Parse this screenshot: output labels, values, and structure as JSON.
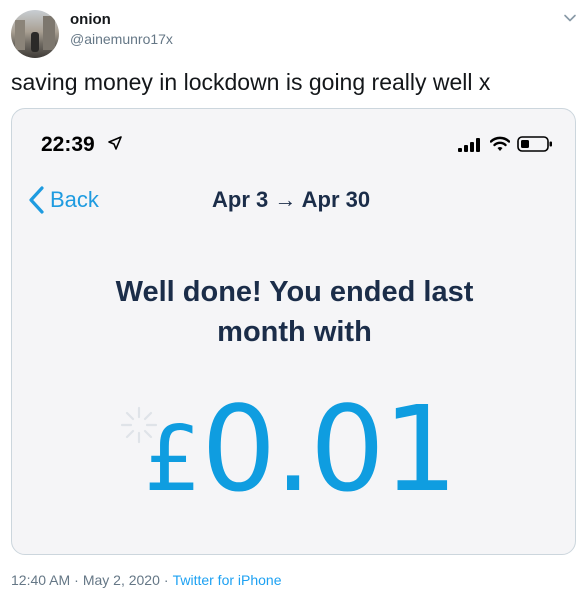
{
  "tweet": {
    "display_name": "onion",
    "handle": "@ainemunro17x",
    "text": "saving money in lockdown is going really well x",
    "timestamp": {
      "time": "12:40 AM",
      "separator_1": "·",
      "date": "May 2, 2020",
      "separator_2": "·",
      "source": "Twitter for iPhone"
    }
  },
  "media": {
    "status_bar": {
      "time": "22:39"
    },
    "nav": {
      "back_label": "Back",
      "date_range": "Apr 3 → Apr 30"
    },
    "message": {
      "line1": "Well done! You ended last",
      "line2": "month with"
    },
    "amount": {
      "currency": "£",
      "value": "0.01"
    },
    "colors": {
      "accent": "#1e9be0",
      "amount": "#0f9de0",
      "heading": "#1b2d49"
    }
  },
  "colors": {
    "link": "#1da1f2",
    "muted": "#657786",
    "border": "#ccd6dd"
  },
  "icons": [
    "avatar",
    "chevron-down-icon",
    "location-arrow-icon",
    "signal-icon",
    "wifi-icon",
    "battery-icon",
    "back-chevron-icon",
    "sparkle-icon"
  ]
}
